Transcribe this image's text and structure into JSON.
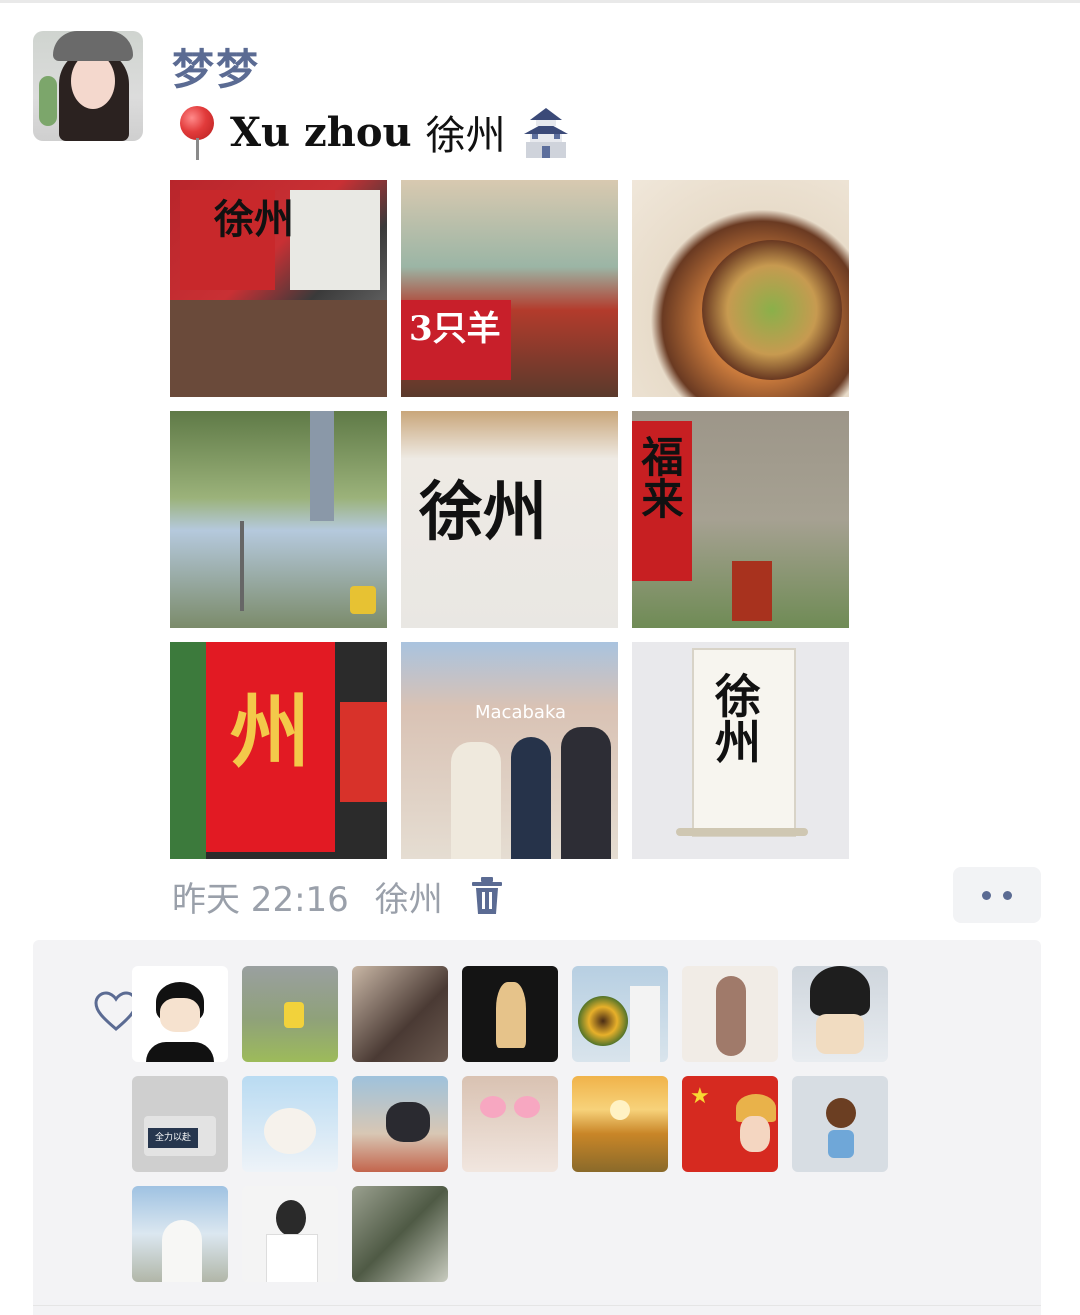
{
  "post": {
    "author_name": "梦梦",
    "location_line": {
      "pin_icon": "round-pushpin-emoji",
      "text_latin": "Xu zhou",
      "text_cn": "徐州",
      "castle_icon": "japanese-castle-emoji"
    },
    "photos": [
      {
        "id": "p1",
        "subject": "xuzhou-signboards-collage",
        "text": "徐州"
      },
      {
        "id": "p2",
        "subject": "snacks-collage",
        "text": "3只羊"
      },
      {
        "id": "p3",
        "subject": "noodle-bowls",
        "text": ""
      },
      {
        "id": "p4",
        "subject": "bamboo-and-tower-collage",
        "text": ""
      },
      {
        "id": "p5",
        "subject": "calligraphy-wall",
        "text": "徐州"
      },
      {
        "id": "p6",
        "subject": "brick-wall-fu-lai",
        "text": "福来"
      },
      {
        "id": "p7",
        "subject": "red-xuzhou-wall",
        "text": "州"
      },
      {
        "id": "p8",
        "subject": "friends-street-selfie",
        "text": "Macabaka"
      },
      {
        "id": "p9",
        "subject": "hanging-scroll",
        "text": "徐州"
      }
    ],
    "timestamp": "昨天 22:16",
    "location_tag": "徐州",
    "delete_icon": "trash-icon",
    "more_icon": "two-dots-icon"
  },
  "likes": {
    "heart_icon": "heart-outline-icon",
    "avatars": [
      {
        "id": "a1",
        "kind": "cartoon-boy"
      },
      {
        "id": "a2",
        "kind": "mountain-hiker"
      },
      {
        "id": "a3",
        "kind": "couple"
      },
      {
        "id": "a4",
        "kind": "girl-dark-background"
      },
      {
        "id": "a5",
        "kind": "sunflower-bouquet"
      },
      {
        "id": "a6",
        "kind": "illustrated-girl-back"
      },
      {
        "id": "a7",
        "kind": "girl-with-bread"
      },
      {
        "id": "a8",
        "kind": "gray-card",
        "text": "全力以赴"
      },
      {
        "id": "a9",
        "kind": "teddy-bear-rainbow"
      },
      {
        "id": "a10",
        "kind": "anime-girl-with-cat"
      },
      {
        "id": "a11",
        "kind": "girl-pink-glasses"
      },
      {
        "id": "a12",
        "kind": "sunflower-field-sunset"
      },
      {
        "id": "a13",
        "kind": "flag-cartoon-couple"
      },
      {
        "id": "a14",
        "kind": "cartoon-pigtail-girl"
      },
      {
        "id": "a15",
        "kind": "wedding-photo"
      },
      {
        "id": "a16",
        "kind": "woman-white-suit"
      },
      {
        "id": "a17",
        "kind": "bamboo-ink"
      }
    ]
  },
  "colors": {
    "name_blue": "#5b6b93",
    "meta_gray": "#9aa0aa",
    "likes_bg": "#f3f3f5"
  }
}
